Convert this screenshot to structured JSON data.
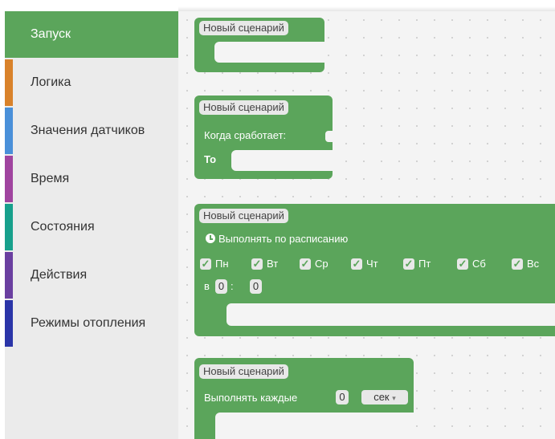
{
  "sidebar": {
    "items": [
      {
        "label": "Запуск",
        "color": "#5ba55b",
        "selected": true
      },
      {
        "label": "Логика",
        "color": "#d9822b"
      },
      {
        "label": "Значения датчиков",
        "color": "#4a90d9"
      },
      {
        "label": "Время",
        "color": "#a0449f"
      },
      {
        "label": "Состояния",
        "color": "#17a08c"
      },
      {
        "label": "Действия",
        "color": "#6a3fa0"
      },
      {
        "label": "Режимы отопления",
        "color": "#2b35a8"
      }
    ]
  },
  "workspace": {
    "block1": {
      "title": "Новый сценарий"
    },
    "block2": {
      "title": "Новый сценарий",
      "when_label": "Когда сработает:",
      "then_label": "То"
    },
    "block3": {
      "title": "Новый сценарий",
      "schedule_label": "Выполнять по расписанию",
      "days": [
        {
          "label": "Пн",
          "checked": true
        },
        {
          "label": "Вт",
          "checked": true
        },
        {
          "label": "Ср",
          "checked": true
        },
        {
          "label": "Чт",
          "checked": true
        },
        {
          "label": "Пт",
          "checked": true
        },
        {
          "label": "Сб",
          "checked": true
        },
        {
          "label": "Вс",
          "checked": true
        }
      ],
      "at_label": "в",
      "hour": "0",
      "separator": ":",
      "minute": "0"
    },
    "block4": {
      "title": "Новый сценарий",
      "repeat_label": "Выполнять каждые",
      "interval": "0",
      "unit": "сек"
    }
  },
  "colors": {
    "block_green": "#5ba55b"
  },
  "icons": {
    "schedule": "clock-icon",
    "unit_dropdown": "dropdown-arrow-icon",
    "checkbox": "checkmark-icon"
  }
}
